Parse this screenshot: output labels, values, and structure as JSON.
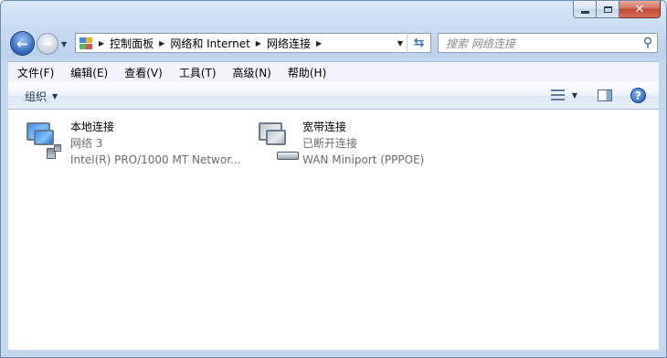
{
  "window": {
    "controls": {
      "minimize": "minimize",
      "maximize": "maximize",
      "close": "close"
    }
  },
  "nav": {
    "breadcrumb": [
      "控制面板",
      "网络和 Internet",
      "网络连接"
    ],
    "search_placeholder": "搜索 网络连接"
  },
  "menu": [
    "文件(F)",
    "编辑(E)",
    "查看(V)",
    "工具(T)",
    "高级(N)",
    "帮助(H)"
  ],
  "toolbar": {
    "organize_label": "组织"
  },
  "connections": [
    {
      "name": "本地连接",
      "status": "网络  3",
      "device": "Intel(R) PRO/1000 MT Networ...",
      "icon": "lan-connection-icon"
    },
    {
      "name": "宽带连接",
      "status": "已断开连接",
      "device": "WAN Miniport (PPPOE)",
      "icon": "broadband-connection-icon"
    }
  ]
}
